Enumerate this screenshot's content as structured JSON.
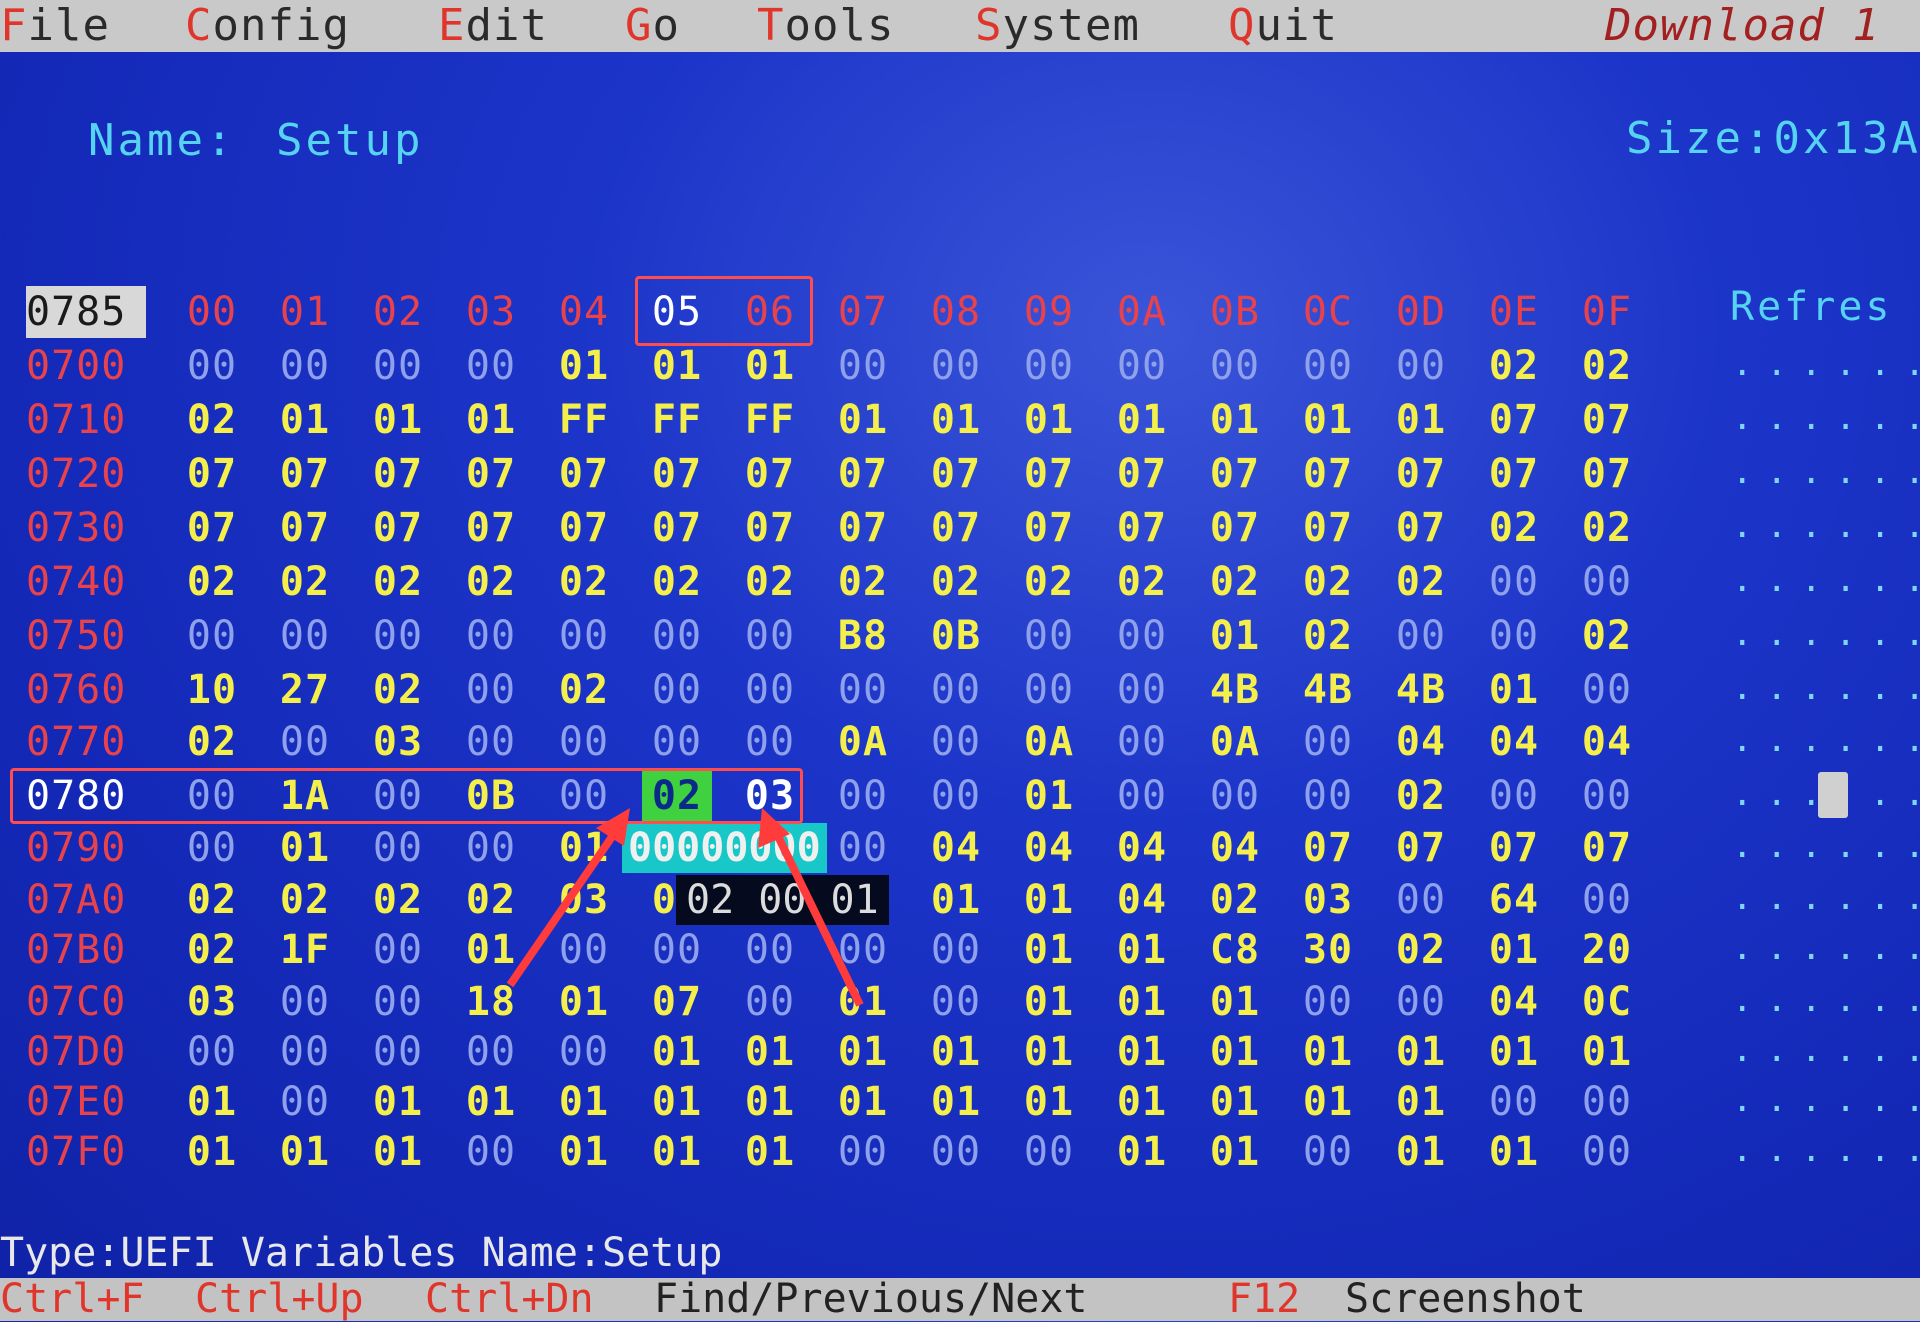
{
  "menu": {
    "file": {
      "hot": "F",
      "rest": "ile"
    },
    "config": {
      "hot": "C",
      "rest": "onfig"
    },
    "edit": {
      "hot": "E",
      "rest": "dit"
    },
    "go": {
      "hot": "G",
      "rest": "o"
    },
    "tools": {
      "hot": "T",
      "rest": "ools"
    },
    "system": {
      "hot": "S",
      "rest": "ystem"
    },
    "quit": {
      "hot": "Q",
      "rest": "uit"
    },
    "download": "Download 1"
  },
  "info": {
    "name_label": "Name:",
    "name_value": "Setup",
    "size": "Size:0x13A",
    "refresh": "Refres"
  },
  "grid": {
    "current_offset": "0785",
    "headers": [
      "00",
      "01",
      "02",
      "03",
      "04",
      "05",
      "06",
      "07",
      "08",
      "09",
      "0A",
      "0B",
      "0C",
      "0D",
      "0E",
      "0F"
    ],
    "rows": [
      {
        "addr": "0700",
        "bytes": [
          "00",
          "00",
          "00",
          "00",
          "01",
          "01",
          "01",
          "00",
          "00",
          "00",
          "00",
          "00",
          "00",
          "00",
          "02",
          "02"
        ]
      },
      {
        "addr": "0710",
        "bytes": [
          "02",
          "01",
          "01",
          "01",
          "FF",
          "FF",
          "FF",
          "01",
          "01",
          "01",
          "01",
          "01",
          "01",
          "01",
          "07",
          "07"
        ]
      },
      {
        "addr": "0720",
        "bytes": [
          "07",
          "07",
          "07",
          "07",
          "07",
          "07",
          "07",
          "07",
          "07",
          "07",
          "07",
          "07",
          "07",
          "07",
          "07",
          "07"
        ]
      },
      {
        "addr": "0730",
        "bytes": [
          "07",
          "07",
          "07",
          "07",
          "07",
          "07",
          "07",
          "07",
          "07",
          "07",
          "07",
          "07",
          "07",
          "07",
          "02",
          "02"
        ]
      },
      {
        "addr": "0740",
        "bytes": [
          "02",
          "02",
          "02",
          "02",
          "02",
          "02",
          "02",
          "02",
          "02",
          "02",
          "02",
          "02",
          "02",
          "02",
          "00",
          "00"
        ]
      },
      {
        "addr": "0750",
        "bytes": [
          "00",
          "00",
          "00",
          "00",
          "00",
          "00",
          "00",
          "B8",
          "0B",
          "00",
          "00",
          "01",
          "02",
          "00",
          "00",
          "02"
        ]
      },
      {
        "addr": "0760",
        "bytes": [
          "10",
          "27",
          "02",
          "00",
          "02",
          "00",
          "00",
          "00",
          "00",
          "00",
          "00",
          "4B",
          "4B",
          "4B",
          "01",
          "00"
        ]
      },
      {
        "addr": "0770",
        "bytes": [
          "02",
          "00",
          "03",
          "00",
          "00",
          "00",
          "00",
          "0A",
          "00",
          "0A",
          "00",
          "0A",
          "00",
          "04",
          "04",
          "04"
        ]
      },
      {
        "addr": "0780",
        "bytes": [
          "00",
          "1A",
          "00",
          "0B",
          "00",
          "02",
          "03",
          "00",
          "00",
          "01",
          "00",
          "00",
          "00",
          "02",
          "00",
          "00"
        ]
      },
      {
        "addr": "0790",
        "bytes": [
          "00",
          "01",
          "00",
          "00",
          "01",
          "00",
          "00",
          "00",
          "04",
          "04",
          "04",
          "04",
          "07",
          "07",
          "07",
          "07"
        ]
      },
      {
        "addr": "07A0",
        "bytes": [
          "02",
          "02",
          "02",
          "02",
          "03",
          "03",
          "02",
          "00",
          "01",
          "01",
          "04",
          "02",
          "03",
          "00",
          "64",
          "00"
        ]
      },
      {
        "addr": "07B0",
        "bytes": [
          "02",
          "1F",
          "00",
          "01",
          "00",
          "00",
          "00",
          "00",
          "00",
          "01",
          "01",
          "C8",
          "30",
          "02",
          "01",
          "20"
        ]
      },
      {
        "addr": "07C0",
        "bytes": [
          "03",
          "00",
          "00",
          "18",
          "01",
          "07",
          "00",
          "01",
          "00",
          "01",
          "01",
          "01",
          "00",
          "00",
          "04",
          "0C"
        ]
      },
      {
        "addr": "07D0",
        "bytes": [
          "00",
          "00",
          "00",
          "00",
          "00",
          "01",
          "01",
          "01",
          "01",
          "01",
          "01",
          "01",
          "01",
          "01",
          "01",
          "01"
        ]
      },
      {
        "addr": "07E0",
        "bytes": [
          "01",
          "00",
          "01",
          "01",
          "01",
          "01",
          "01",
          "01",
          "01",
          "01",
          "01",
          "01",
          "01",
          "01",
          "00",
          "00"
        ]
      },
      {
        "addr": "07F0",
        "bytes": [
          "01",
          "01",
          "01",
          "00",
          "01",
          "01",
          "01",
          "00",
          "00",
          "00",
          "01",
          "01",
          "00",
          "01",
          "01",
          "00"
        ]
      }
    ],
    "edit_field": "00000000",
    "edit_popup": "02 00 01"
  },
  "status": {
    "type_line": "Type:UEFI Variables   Name:Setup"
  },
  "footer": {
    "k1": "Ctrl+F",
    "k2": "Ctrl+Up",
    "k3": "Ctrl+Dn",
    "d1": "Find/Previous/Next",
    "k4": "F12",
    "d2": "Screenshot"
  },
  "colors": {
    "background": "#1c35c9",
    "value": "#f4ef4a",
    "zero": "#8fa1ea",
    "address": "#e8424a",
    "annotation": "#ff4c4c",
    "selected_byte": "#3fd13f"
  }
}
